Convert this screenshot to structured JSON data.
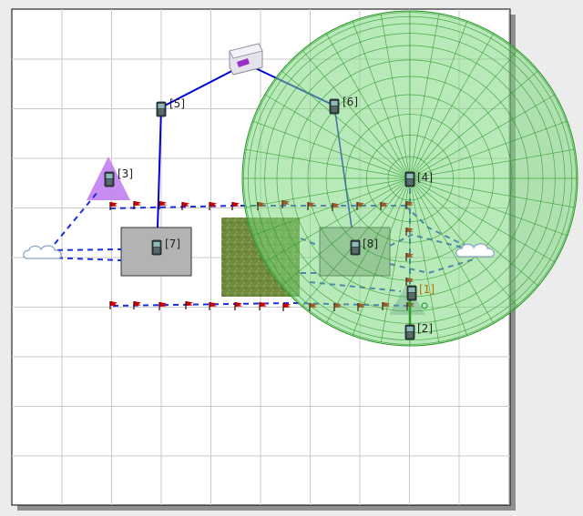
{
  "canvas": {
    "grid": true,
    "colors": {
      "page": "#ffffff",
      "grid": "#c9c9c9",
      "shadow": "#8f8f8f",
      "link": "#0000d8",
      "dashed_link": "#1a2ee0",
      "sphere_fill": "#7ed77e",
      "sphere_line": "#2e9a2e",
      "red_flag": "#c80000",
      "brown_flag": "#9a5a2a",
      "purple": "#c080f0",
      "gray_box": "#b3b3b3"
    }
  },
  "nodes": {
    "n1": {
      "label": "[1]"
    },
    "n2": {
      "label": "[2]"
    },
    "n3": {
      "label": "[3]"
    },
    "n4": {
      "label": "[4]"
    },
    "n5": {
      "label": "[5]"
    },
    "n6": {
      "label": "[6]"
    },
    "n7": {
      "label": "[7]"
    },
    "n8": {
      "label": "[8]"
    }
  },
  "icons": {
    "router": "router-icon",
    "phone": "mobile-phone-icon",
    "cloud": "cloud-icon",
    "flag": "waypoint-flag-icon"
  }
}
